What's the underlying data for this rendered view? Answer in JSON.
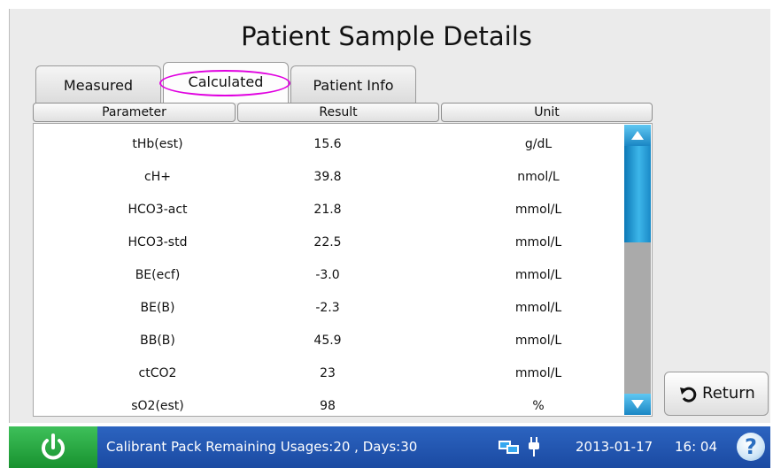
{
  "title": "Patient Sample Details",
  "tabs": [
    {
      "label": "Measured",
      "active": false
    },
    {
      "label": "Calculated",
      "active": true
    },
    {
      "label": "Patient Info",
      "active": false
    }
  ],
  "table": {
    "headers": [
      "Parameter",
      "Result",
      "Unit"
    ],
    "rows": [
      {
        "parameter": "tHb(est)",
        "result": "15.6",
        "unit": "g/dL"
      },
      {
        "parameter": "cH+",
        "result": "39.8",
        "unit": "nmol/L"
      },
      {
        "parameter": "HCO3-act",
        "result": "21.8",
        "unit": "mmol/L"
      },
      {
        "parameter": "HCO3-std",
        "result": "22.5",
        "unit": "mmol/L"
      },
      {
        "parameter": "BE(ecf)",
        "result": "-3.0",
        "unit": "mmol/L"
      },
      {
        "parameter": "BE(B)",
        "result": "-2.3",
        "unit": "mmol/L"
      },
      {
        "parameter": "BB(B)",
        "result": "45.9",
        "unit": "mmol/L"
      },
      {
        "parameter": "ctCO2",
        "result": "23",
        "unit": "mmol/L"
      },
      {
        "parameter": "sO2(est)",
        "result": "98",
        "unit": "%"
      }
    ]
  },
  "return_label": "Return",
  "status_bar": {
    "message": "Calibrant Pack Remaining Usages:20 , Days:30",
    "date": "2013-01-17",
    "time": "16: 04",
    "help": "?"
  },
  "colors": {
    "status_bar": "#1f52ad",
    "power_button": "#28a744",
    "scroll_thumb": "#2a9fdc",
    "highlight_ring": "#e000e0"
  },
  "icons": [
    "power-icon",
    "network-icon",
    "plug-icon",
    "help-icon",
    "return-icon",
    "scroll-up-icon",
    "scroll-down-icon"
  ]
}
